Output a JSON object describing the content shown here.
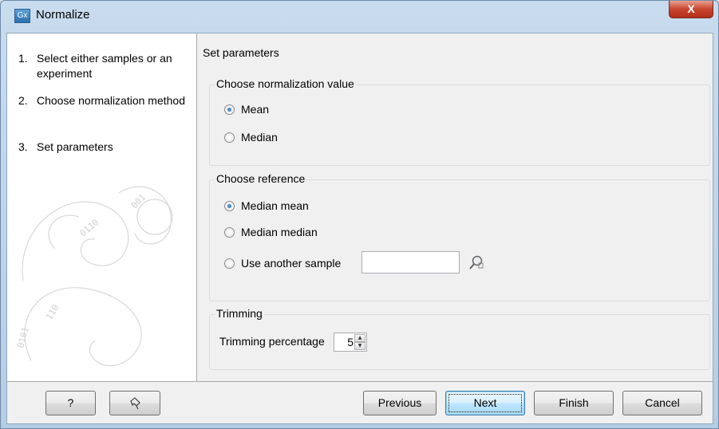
{
  "window": {
    "title": "Normalize",
    "app_icon_text": "Gx",
    "close_glyph": "X"
  },
  "steps": [
    {
      "num": "1.",
      "label": "Select either samples or an experiment"
    },
    {
      "num": "2.",
      "label": "Choose normalization method"
    },
    {
      "num": "3.",
      "label": "Set parameters"
    }
  ],
  "panel": {
    "title": "Set parameters",
    "normalization_group": {
      "title": "Choose normalization value",
      "options": [
        {
          "label": "Mean",
          "checked": true
        },
        {
          "label": "Median",
          "checked": false
        }
      ]
    },
    "reference_group": {
      "title": "Choose reference",
      "options": [
        {
          "label": "Median mean",
          "checked": true
        },
        {
          "label": "Median median",
          "checked": false
        },
        {
          "label": "Use another sample",
          "checked": false
        }
      ],
      "sample_value": ""
    },
    "trimming_group": {
      "title": "Trimming",
      "label": "Trimming percentage",
      "value": "5"
    }
  },
  "footer": {
    "help_label": "?",
    "previous_label": "Previous",
    "next_label": "Next",
    "finish_label": "Finish",
    "cancel_label": "Cancel"
  },
  "icons": [
    "app-icon",
    "close-icon",
    "browse-icon",
    "reset-icon",
    "spin-up-icon",
    "spin-down-icon"
  ]
}
